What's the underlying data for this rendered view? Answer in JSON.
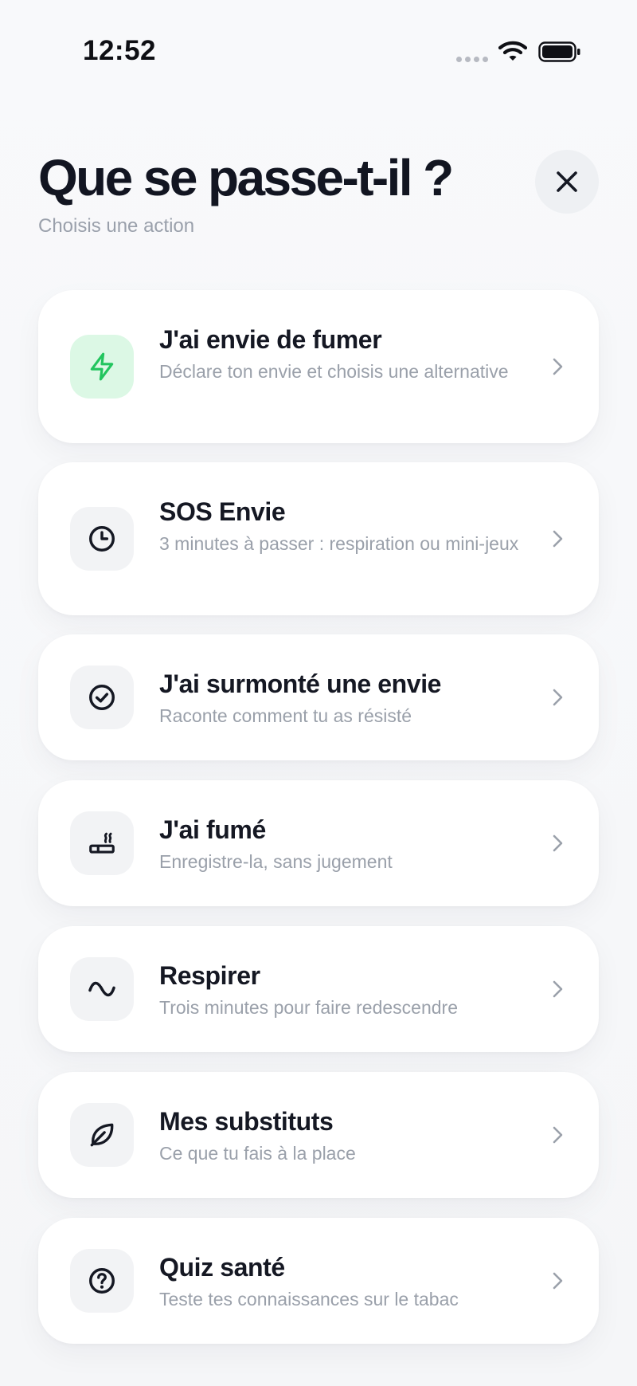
{
  "status_bar": {
    "time": "12:52",
    "icons": [
      "signal-dots-icon",
      "wifi-icon",
      "battery-icon"
    ]
  },
  "header": {
    "title": "Que se passe-t-il ?",
    "subtitle": "Choisis une action",
    "close_icon": "close-icon"
  },
  "colors": {
    "accent_green": "#22c55e",
    "accent_green_bg": "#dcf8e5",
    "text_primary": "#151823",
    "text_secondary": "#9aa0aa",
    "card_bg": "#ffffff",
    "page_bg": "#f7f8fa"
  },
  "actions": [
    {
      "title": "J'ai envie de fumer",
      "description": "Déclare ton envie et choisis une alternative",
      "icon": "lightning-icon"
    },
    {
      "title": "SOS Envie",
      "description": "3 minutes à passer : respiration ou mini-jeux",
      "icon": "clock-icon"
    },
    {
      "title": "J'ai surmonté une envie",
      "description": "Raconte comment tu as résisté",
      "icon": "check-circle-icon"
    },
    {
      "title": "J'ai fumé",
      "description": "Enregistre-la, sans jugement",
      "icon": "cigarette-icon"
    },
    {
      "title": "Respirer",
      "description": "Trois minutes pour faire redescendre",
      "icon": "wave-icon"
    },
    {
      "title": "Mes substituts",
      "description": "Ce que tu fais à la place",
      "icon": "leaf-icon"
    },
    {
      "title": "Quiz santé",
      "description": "Teste tes connaissances sur le tabac",
      "icon": "question-circle-icon"
    }
  ]
}
